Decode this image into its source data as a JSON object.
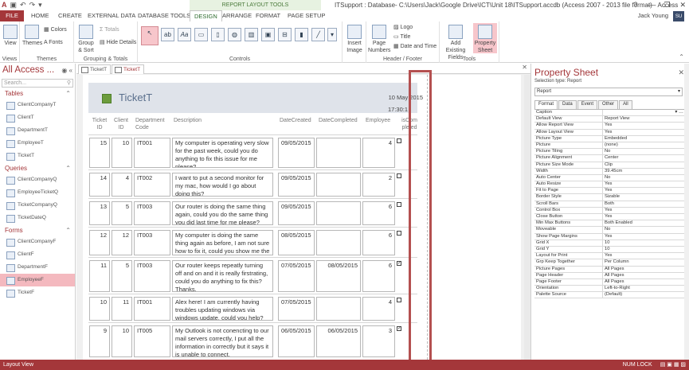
{
  "app": {
    "title": "ITSupport : Database- C:\\Users\\Jack\\Google Drive\\ICT\\Unit 18\\ITSupport.accdb (Access 2007 - 2013 file format) - Access",
    "context_tab_group": "REPORT LAYOUT TOOLS",
    "user": "Jack Young",
    "avatar": "SU",
    "window_controls": [
      "?",
      "—",
      "❐",
      "✕"
    ]
  },
  "tabs": [
    {
      "label": "FILE",
      "active": false
    },
    {
      "label": "HOME",
      "active": false
    },
    {
      "label": "CREATE",
      "active": false
    },
    {
      "label": "EXTERNAL DATA",
      "active": false
    },
    {
      "label": "DATABASE TOOLS",
      "active": false
    },
    {
      "label": "DESIGN",
      "active": true
    },
    {
      "label": "ARRANGE",
      "active": false
    },
    {
      "label": "FORMAT",
      "active": false
    },
    {
      "label": "PAGE SETUP",
      "active": false
    }
  ],
  "ribbon": {
    "views": {
      "label": "View",
      "group": "Views"
    },
    "themes": {
      "themes": "Themes",
      "colors": "Colors",
      "fonts": "Fonts",
      "group": "Themes"
    },
    "grouping": {
      "group_sort": "Group & Sort",
      "totals": "Totals",
      "hide_details": "Hide Details",
      "group": "Grouping & Totals"
    },
    "controls": {
      "group": "Controls"
    },
    "insert_image": "Insert Image",
    "header_footer": {
      "page_numbers": "Page Numbers",
      "logo": "Logo",
      "title": "Title",
      "date_time": "Date and Time",
      "group": "Header / Footer"
    },
    "tools": {
      "add_fields": "Add Existing Fields",
      "property_sheet": "Property Sheet",
      "group": "Tools"
    }
  },
  "nav": {
    "title": "All Access ...",
    "search_placeholder": "Search...",
    "sections": [
      {
        "name": "Tables",
        "items": [
          "ClientCompanyT",
          "ClientT",
          "DepartmentT",
          "EmployeeT",
          "TicketT"
        ]
      },
      {
        "name": "Queries",
        "items": [
          "ClientCompanyQ",
          "EmployeeTicketQ",
          "TicketCompanyQ",
          "TicketDateQ"
        ]
      },
      {
        "name": "Forms",
        "items": [
          "ClientCompanyF",
          "ClientF",
          "DepartmentF",
          "EmployeeF",
          "TicketF"
        ]
      }
    ],
    "selected": "EmployeeF"
  },
  "doc_tabs": [
    "TicketT",
    "TicketT"
  ],
  "report": {
    "title": "TicketT",
    "date": "10 May 2015",
    "time": "17:30:1",
    "headers": {
      "ticket": "Ticket ID",
      "client": "Client ID",
      "dept": "Department Code",
      "desc": "Description",
      "created": "DateCreated",
      "completed": "DateCompleted",
      "employee": "Employee",
      "iscomp": "isCom pleted"
    },
    "rows": [
      {
        "ticket": "15",
        "client": "10",
        "dept": "IT001",
        "desc": "My computer is operating very slow for the past week, could you do anything to fix this issue for me please?",
        "created": "09/05/2015",
        "completed": "",
        "employee": "4",
        "checked": false
      },
      {
        "ticket": "14",
        "client": "4",
        "dept": "IT002",
        "desc": "I want to put a second monitor for my mac, how would I go about doing this?",
        "created": "09/05/2015",
        "completed": "",
        "employee": "2",
        "checked": false
      },
      {
        "ticket": "13",
        "client": "5",
        "dept": "IT003",
        "desc": "Our router is doing the same thing again, could you do the same thing you did last time for me please?",
        "created": "09/05/2015",
        "completed": "",
        "employee": "6",
        "checked": false
      },
      {
        "ticket": "12",
        "client": "12",
        "dept": "IT003",
        "desc": "My computer is doing the same thing again as before, I am not sure how to fix it, could you show me the steps again?",
        "created": "08/05/2015",
        "completed": "",
        "employee": "6",
        "checked": false
      },
      {
        "ticket": "11",
        "client": "5",
        "dept": "IT003",
        "desc": "Our router keeps repeatly turning off and on and it is really firstrating, could you do anything to fix this? Thanks.",
        "created": "07/05/2015",
        "completed": "08/05/2015",
        "employee": "6",
        "checked": true
      },
      {
        "ticket": "10",
        "client": "11",
        "dept": "IT001",
        "desc": "Alex here! I am currently having troubles updating windows via windows update, could you help?",
        "created": "07/05/2015",
        "completed": "",
        "employee": "4",
        "checked": false
      },
      {
        "ticket": "9",
        "client": "10",
        "dept": "IT005",
        "desc": "My Outlook is not conencting to our mail servers correctly, I put all the information in correctly but it says it is unable to connect.",
        "created": "06/05/2015",
        "completed": "06/05/2015",
        "employee": "3",
        "checked": true
      }
    ]
  },
  "property_sheet": {
    "title": "Property Sheet",
    "selection_type": "Selection type:  Report",
    "object": "Report",
    "tabs": [
      "Format",
      "Data",
      "Event",
      "Other",
      "All"
    ],
    "props": [
      [
        "Caption",
        ""
      ],
      [
        "Default View",
        "Report View"
      ],
      [
        "Allow Report View",
        "Yes"
      ],
      [
        "Allow Layout View",
        "Yes"
      ],
      [
        "Picture Type",
        "Embedded"
      ],
      [
        "Picture",
        "(none)"
      ],
      [
        "Picture Tiling",
        "No"
      ],
      [
        "Picture Alignment",
        "Center"
      ],
      [
        "Picture Size Mode",
        "Clip"
      ],
      [
        "Width",
        "39.45cm"
      ],
      [
        "Auto Center",
        "No"
      ],
      [
        "Auto Resize",
        "Yes"
      ],
      [
        "Fit to Page",
        "Yes"
      ],
      [
        "Border Style",
        "Sizable"
      ],
      [
        "Scroll Bars",
        "Both"
      ],
      [
        "Control Box",
        "Yes"
      ],
      [
        "Close Button",
        "Yes"
      ],
      [
        "Min Max Buttons",
        "Both Enabled"
      ],
      [
        "Moveable",
        "No"
      ],
      [
        "Show Page Margins",
        "Yes"
      ],
      [
        "Grid X",
        "10"
      ],
      [
        "Grid Y",
        "10"
      ],
      [
        "Layout for Print",
        "Yes"
      ],
      [
        "Grp Keep Together",
        "Per Column"
      ],
      [
        "Picture Pages",
        "All Pages"
      ],
      [
        "Page Header",
        "All Pages"
      ],
      [
        "Page Footer",
        "All Pages"
      ],
      [
        "Orientation",
        "Left-to-Right"
      ],
      [
        "Palette Source",
        "(Default)"
      ]
    ]
  },
  "status": {
    "left": "Layout View",
    "num_lock": "NUM LOCK"
  }
}
